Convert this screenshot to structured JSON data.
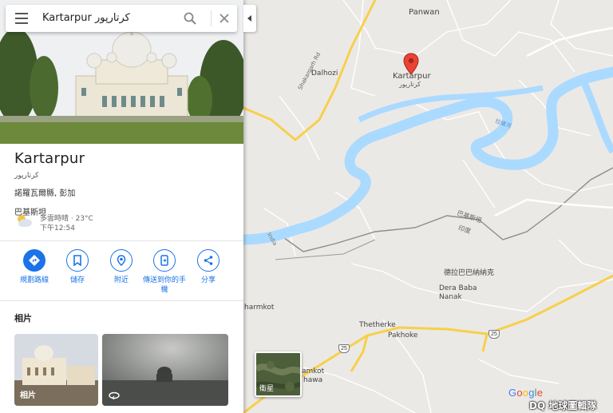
{
  "search": {
    "query": "Kartarpur کرتارپور"
  },
  "place": {
    "name": "Kartarpur",
    "native_name": "کرتارپور",
    "region": "諾羅瓦爾縣, 彭加",
    "country": "巴基斯坦",
    "weather": {
      "condition": "多雲時晴",
      "temperature": "23°C",
      "time": "下午12:54"
    }
  },
  "actions": [
    {
      "label": "規劃路線",
      "icon": "directions-icon"
    },
    {
      "label": "儲存",
      "icon": "bookmark-icon"
    },
    {
      "label": "附近",
      "icon": "nearby-icon"
    },
    {
      "label": "傳送到你的手機",
      "icon": "send-to-phone-icon"
    },
    {
      "label": "分享",
      "icon": "share-icon"
    }
  ],
  "photos": {
    "heading": "相片",
    "items": [
      {
        "label": "相片"
      },
      {
        "label": ""
      }
    ]
  },
  "map": {
    "pin": {
      "label": "Kartarpur",
      "native": "کرتارپور"
    },
    "places": [
      "Panwan",
      "Dalhozi",
      "德拉巴巴納納克",
      "Dera Baba Nanak",
      "Thetherke",
      "Pakhoke",
      "harmkot",
      "amkot",
      "hawa"
    ],
    "roads": [
      "Shakargarh Rd",
      "India"
    ],
    "route_shields": [
      "25",
      "25"
    ],
    "river_labels": [
      "拉維河"
    ],
    "border_labels": [
      "巴基斯坦",
      "印度"
    ],
    "satellite_label": "衛星",
    "colors": {
      "water": "#aadaff",
      "road_major": "#f7d04a",
      "land": "#ebe9e6",
      "pin": "#ea4335"
    }
  },
  "branding": {
    "google": "Google",
    "watermark": "DQ 地球圖輯隊"
  }
}
